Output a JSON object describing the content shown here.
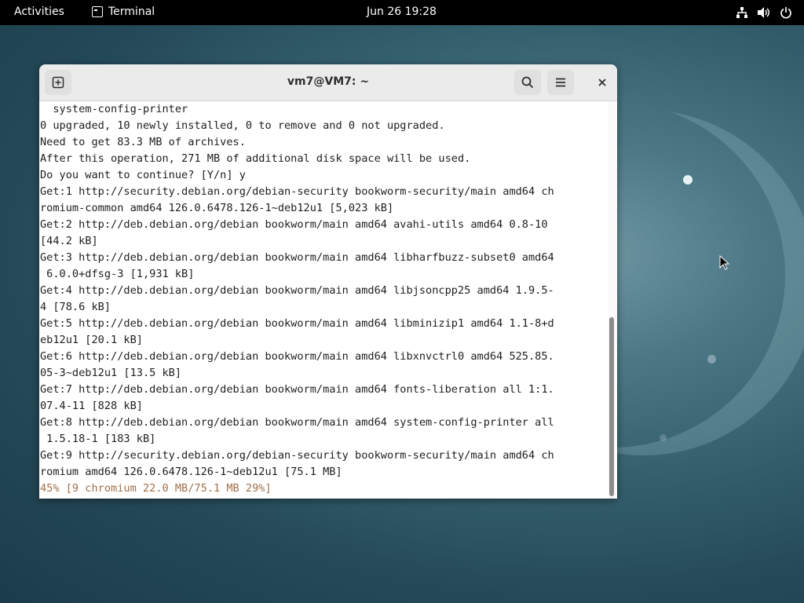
{
  "topbar": {
    "activities_label": "Activities",
    "app_label": "Terminal",
    "clock": "Jun 26  19:28",
    "tray_icons": [
      "network-icon",
      "volume-icon",
      "power-icon"
    ]
  },
  "window": {
    "title": "vm7@VM7: ~",
    "buttons": [
      "new-tab-icon",
      "search-icon",
      "hamburger-menu-icon",
      "close-icon"
    ]
  },
  "terminal": {
    "lines": [
      "  system-config-printer",
      "0 upgraded, 10 newly installed, 0 to remove and 0 not upgraded.",
      "Need to get 83.3 MB of archives.",
      "After this operation, 271 MB of additional disk space will be used.",
      "Do you want to continue? [Y/n] y",
      "Get:1 http://security.debian.org/debian-security bookworm-security/main amd64 ch",
      "romium-common amd64 126.0.6478.126-1~deb12u1 [5,023 kB]",
      "Get:2 http://deb.debian.org/debian bookworm/main amd64 avahi-utils amd64 0.8-10",
      "[44.2 kB]",
      "Get:3 http://deb.debian.org/debian bookworm/main amd64 libharfbuzz-subset0 amd64",
      " 6.0.0+dfsg-3 [1,931 kB]",
      "Get:4 http://deb.debian.org/debian bookworm/main amd64 libjsoncpp25 amd64 1.9.5-",
      "4 [78.6 kB]",
      "Get:5 http://deb.debian.org/debian bookworm/main amd64 libminizip1 amd64 1.1-8+d",
      "eb12u1 [20.1 kB]",
      "Get:6 http://deb.debian.org/debian bookworm/main amd64 libxnvctrl0 amd64 525.85.",
      "05-3~deb12u1 [13.5 kB]",
      "Get:7 http://deb.debian.org/debian bookworm/main amd64 fonts-liberation all 1:1.",
      "07.4-11 [828 kB]",
      "Get:8 http://deb.debian.org/debian bookworm/main amd64 system-config-printer all",
      " 1.5.18-1 [183 kB]",
      "Get:9 http://security.debian.org/debian-security bookworm-security/main amd64 ch",
      "romium amd64 126.0.6478.126-1~deb12u1 [75.1 MB]"
    ],
    "progress_line": "45% [9 chromium 22.0 MB/75.1 MB 29%]"
  },
  "colors": {
    "topbar_bg": "#000000",
    "progress_text": "#a0704a",
    "terminal_bg": "#ffffff"
  }
}
